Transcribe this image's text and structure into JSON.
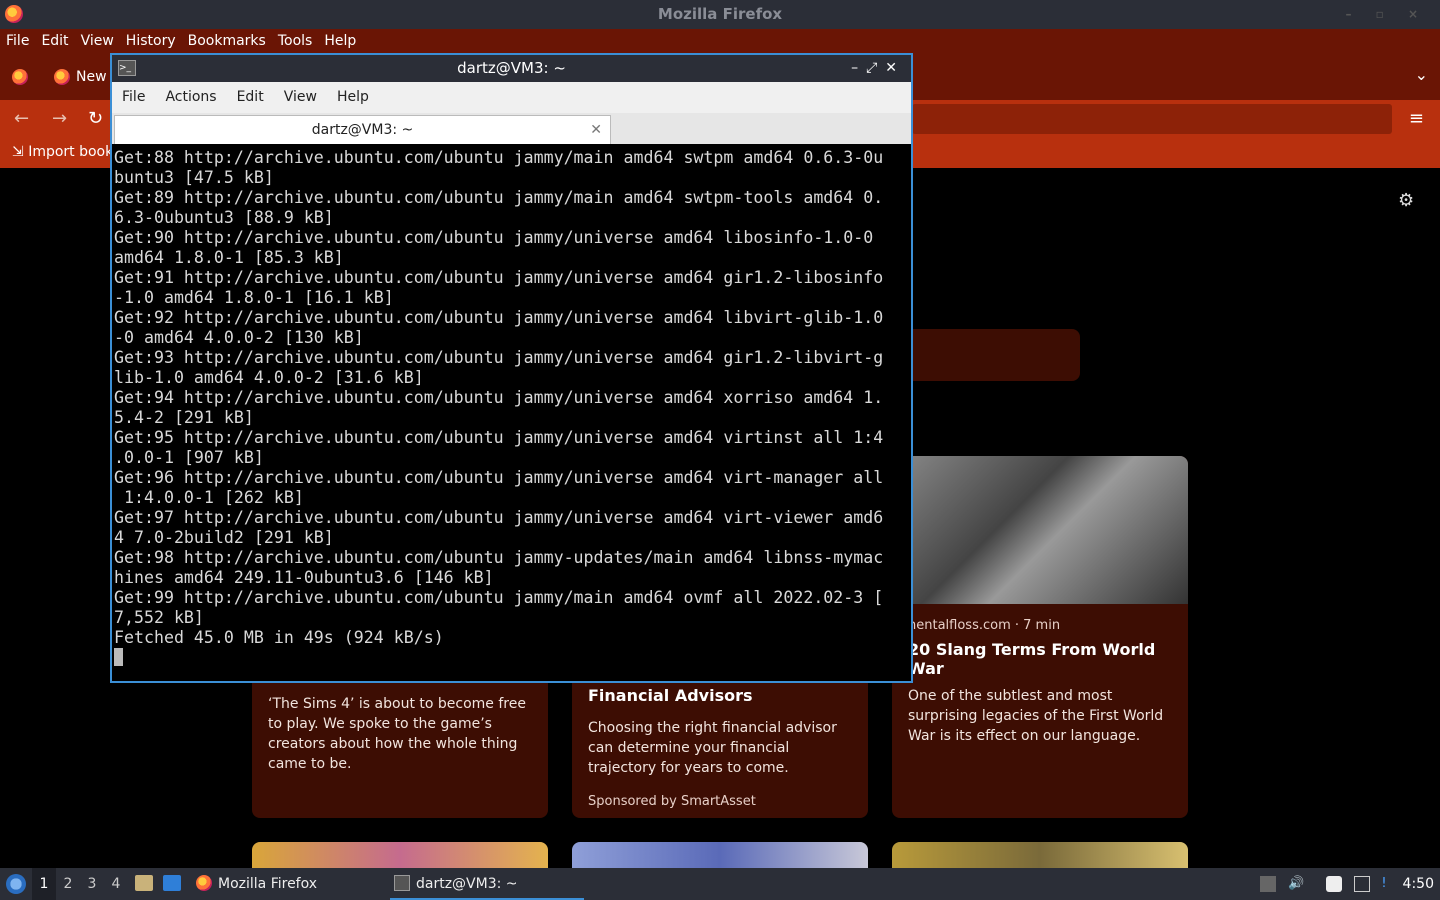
{
  "firefox": {
    "window_title": "Mozilla Firefox",
    "menu": [
      "File",
      "Edit",
      "View",
      "History",
      "Bookmarks",
      "Tools",
      "Help"
    ],
    "tab_label": "New",
    "bookmarks_import": "Import book",
    "cards": [
      {
        "source": "",
        "title": "",
        "desc": "‘The Sims 4’ is about to become free to play. We spoke to the game’s creators about how the whole thing came to be.",
        "sponsor": ""
      },
      {
        "source": "",
        "title": "Financial Advisors",
        "desc": "Choosing the right financial advisor can determine your financial trajectory for years to come.",
        "sponsor": "Sponsored by SmartAsset"
      },
      {
        "source": "nentalfloss.com · 7 min",
        "title": "20 Slang Terms From World War",
        "desc": "One of the subtlest and most surprising legacies of the First World War is its effect on our language.",
        "sponsor": ""
      }
    ]
  },
  "terminal": {
    "window_title": "dartz@VM3: ~",
    "menu": [
      "File",
      "Actions",
      "Edit",
      "View",
      "Help"
    ],
    "tab_title": "dartz@VM3: ~",
    "lines": [
      "Get:88 http://archive.ubuntu.com/ubuntu jammy/main amd64 swtpm amd64 0.6.3-0u",
      "buntu3 [47.5 kB]",
      "Get:89 http://archive.ubuntu.com/ubuntu jammy/main amd64 swtpm-tools amd64 0.",
      "6.3-0ubuntu3 [88.9 kB]",
      "Get:90 http://archive.ubuntu.com/ubuntu jammy/universe amd64 libosinfo-1.0-0",
      "amd64 1.8.0-1 [85.3 kB]",
      "Get:91 http://archive.ubuntu.com/ubuntu jammy/universe amd64 gir1.2-libosinfo",
      "-1.0 amd64 1.8.0-1 [16.1 kB]",
      "Get:92 http://archive.ubuntu.com/ubuntu jammy/universe amd64 libvirt-glib-1.0",
      "-0 amd64 4.0.0-2 [130 kB]",
      "Get:93 http://archive.ubuntu.com/ubuntu jammy/universe amd64 gir1.2-libvirt-g",
      "lib-1.0 amd64 4.0.0-2 [31.6 kB]",
      "Get:94 http://archive.ubuntu.com/ubuntu jammy/universe amd64 xorriso amd64 1.",
      "5.4-2 [291 kB]",
      "Get:95 http://archive.ubuntu.com/ubuntu jammy/universe amd64 virtinst all 1:4",
      ".0.0-1 [907 kB]",
      "Get:96 http://archive.ubuntu.com/ubuntu jammy/universe amd64 virt-manager all",
      " 1:4.0.0-1 [262 kB]",
      "Get:97 http://archive.ubuntu.com/ubuntu jammy/universe amd64 virt-viewer amd6",
      "4 7.0-2build2 [291 kB]",
      "Get:98 http://archive.ubuntu.com/ubuntu jammy-updates/main amd64 libnss-mymac",
      "hines amd64 249.11-0ubuntu3.6 [146 kB]",
      "Get:99 http://archive.ubuntu.com/ubuntu jammy/main amd64 ovmf all 2022.02-3 [",
      "7,552 kB]",
      "Fetched 45.0 MB in 49s (924 kB/s)"
    ]
  },
  "taskbar": {
    "workspaces": [
      "1",
      "2",
      "3",
      "4"
    ],
    "tasks": [
      {
        "label": "Mozilla Firefox",
        "icon": "firefox-icon"
      },
      {
        "label": "dartz@VM3: ~",
        "icon": "terminal-icon"
      }
    ],
    "clock": "4:50"
  }
}
